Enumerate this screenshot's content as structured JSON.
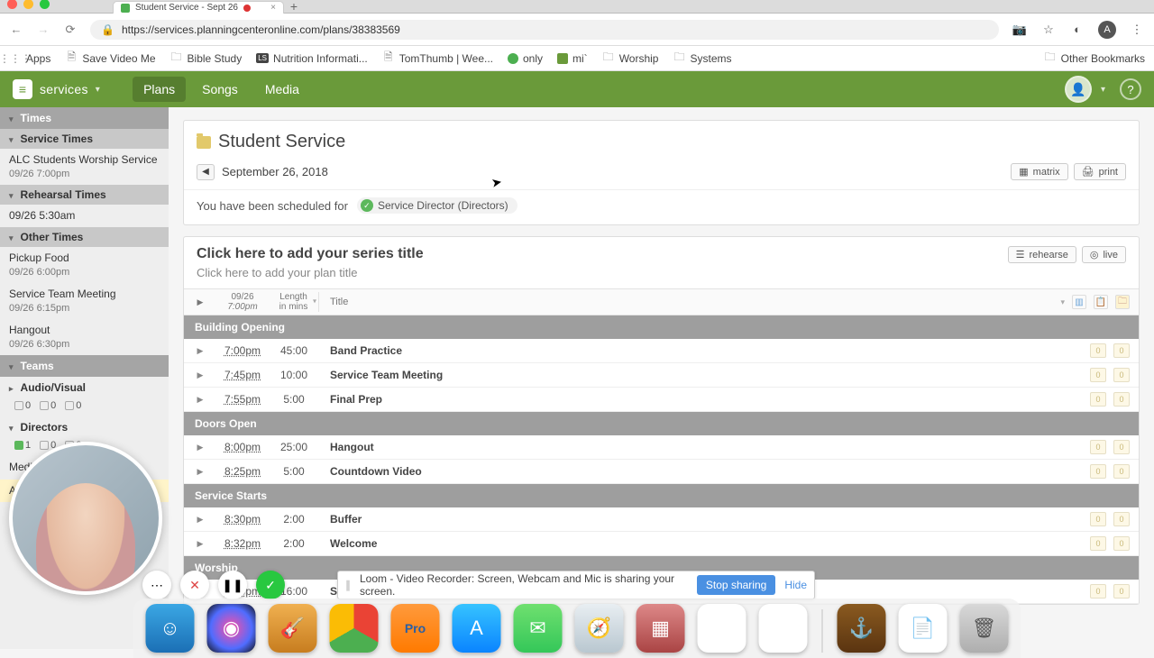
{
  "browser": {
    "tab_title": "Student Service - Sept 26",
    "url": "https://services.planningcenteronline.com/plans/38383569",
    "bookmarks": [
      "Apps",
      "Save Video Me",
      "Bible Study",
      "Nutrition Informati...",
      "TomThumb | Wee...",
      "only",
      "mi`",
      "Worship",
      "Systems"
    ],
    "other_bookmarks": "Other Bookmarks",
    "avatar_letter": "A"
  },
  "nav": {
    "brand": "services",
    "items": [
      "Plans",
      "Songs",
      "Media"
    ]
  },
  "sidebar": {
    "times": "Times",
    "service_times": "Service Times",
    "service": {
      "name": "ALC Students Worship Service",
      "when": "09/26 7:00pm"
    },
    "rehearsal_times": "Rehearsal Times",
    "rehearsal": {
      "when": "09/26 5:30am"
    },
    "other_times": "Other Times",
    "others": [
      {
        "name": "Pickup Food",
        "when": "09/26 6:00pm"
      },
      {
        "name": "Service Team Meeting",
        "when": "09/26 6:15pm"
      },
      {
        "name": "Hangout",
        "when": "09/26 6:30pm"
      }
    ],
    "teams": "Teams",
    "team_list": [
      {
        "name": "Audio/Visual",
        "c": [
          0,
          0,
          0
        ]
      },
      {
        "name": "Directors",
        "c": [
          1,
          0,
          2
        ]
      }
    ],
    "media_director": "Media Director",
    "and": "And",
    "se": "Se"
  },
  "header": {
    "service_name": "Student Service",
    "date": "September 26, 2018",
    "scheduled_for": "You have been scheduled for",
    "role": "Service Director (Directors)",
    "matrix": "matrix",
    "print": "print"
  },
  "plan": {
    "series_placeholder": "Click here to add your series title",
    "title_placeholder": "Click here to add your plan title",
    "rehearse": "rehearse",
    "live": "live",
    "col_date": "09/26",
    "col_time": "7:00pm",
    "col_len1": "Length",
    "col_len2": "in mins",
    "col_title": "Title",
    "sections": [
      {
        "name": "Building Opening",
        "items": [
          {
            "t": "7:00pm",
            "l": "45:00",
            "title": "Band Practice"
          },
          {
            "t": "7:45pm",
            "l": "10:00",
            "title": "Service Team Meeting"
          },
          {
            "t": "7:55pm",
            "l": "5:00",
            "title": "Final Prep"
          }
        ]
      },
      {
        "name": "Doors Open",
        "items": [
          {
            "t": "8:00pm",
            "l": "25:00",
            "title": "Hangout"
          },
          {
            "t": "8:25pm",
            "l": "5:00",
            "title": "Countdown Video"
          }
        ]
      },
      {
        "name": "Service Starts",
        "items": [
          {
            "t": "8:30pm",
            "l": "2:00",
            "title": "Buffer"
          },
          {
            "t": "8:32pm",
            "l": "2:00",
            "title": "Welcome"
          }
        ]
      },
      {
        "name": "Worship",
        "items": [
          {
            "t": "8:50pm",
            "l": "16:00",
            "title": "Songs"
          }
        ]
      }
    ]
  },
  "loom": {
    "msg": "Loom - Video Recorder: Screen, Webcam and Mic is sharing your screen.",
    "stop": "Stop sharing",
    "hide": "Hide"
  },
  "dock": {
    "apps": [
      {
        "name": "finder",
        "bg": "linear-gradient(#3ba7e4,#1b6fb5)",
        "glyph": "☺"
      },
      {
        "name": "siri",
        "bg": "radial-gradient(circle,#ff4fa3,#4f6cff 60%,#111)",
        "glyph": "◉"
      },
      {
        "name": "garageband",
        "bg": "linear-gradient(#f0b050,#c77d1f)",
        "glyph": "🎸"
      },
      {
        "name": "chrome",
        "bg": "conic-gradient(#ea4335 0 120deg,#4caf50 120deg 240deg,#fbbc05 240deg 360deg)",
        "glyph": ""
      },
      {
        "name": "propresenter",
        "bg": "linear-gradient(#ff9a3c,#ff7a00)",
        "glyph": "Pro"
      },
      {
        "name": "appstore",
        "bg": "linear-gradient(#36c3ff,#0a84ff)",
        "glyph": "A"
      },
      {
        "name": "messages",
        "bg": "linear-gradient(#6fe06f,#34c759)",
        "glyph": "✉"
      },
      {
        "name": "safari",
        "bg": "linear-gradient(#e8eef2,#b9c7d0)",
        "glyph": "🧭"
      },
      {
        "name": "numbers",
        "bg": "linear-gradient(#d88,#a44)",
        "glyph": "▦"
      },
      {
        "name": "loom",
        "bg": "#fff",
        "glyph": "✱"
      },
      {
        "name": "activity",
        "bg": "#fff",
        "glyph": "◕"
      }
    ],
    "right": [
      {
        "name": "anno1602",
        "bg": "linear-gradient(#8a5a20,#5a3410)",
        "glyph": "⚓"
      },
      {
        "name": "textedit",
        "bg": "#fff",
        "glyph": "📄"
      },
      {
        "name": "trash",
        "bg": "linear-gradient(#d8d8d8,#aeaeae)",
        "glyph": "🗑"
      }
    ]
  }
}
